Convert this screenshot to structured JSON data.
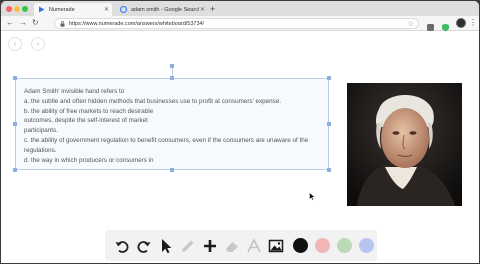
{
  "browser": {
    "tabs": [
      {
        "label": "Numerade",
        "active": true
      },
      {
        "label": "adam smith - Google Search",
        "active": false
      }
    ],
    "url": "https://www.numerade.com/answers/whiteboard/53734/"
  },
  "question": {
    "lines": [
      "Adam Smith' invisible hand refers to",
      "a. the subtle and often hidden methods that businesses use to profit at consumers' expense.",
      "b. the ability of free markets to reach desirable",
      "outcomes, despite the self-interest of market",
      "participants.",
      "c. the ability of government regulation to benefit consumers, even if the consumers are unaware of the",
      "regulations.",
      "d. the way in which producers or consumers in"
    ]
  },
  "toolbar": {
    "tools": [
      "undo-icon",
      "redo-icon",
      "pointer-icon",
      "pen-icon",
      "add-icon",
      "eraser-icon",
      "text-icon",
      "image-icon"
    ],
    "colors": [
      "#111111",
      "#f2b5b5",
      "#bcd9b8",
      "#b9c4ef"
    ]
  }
}
